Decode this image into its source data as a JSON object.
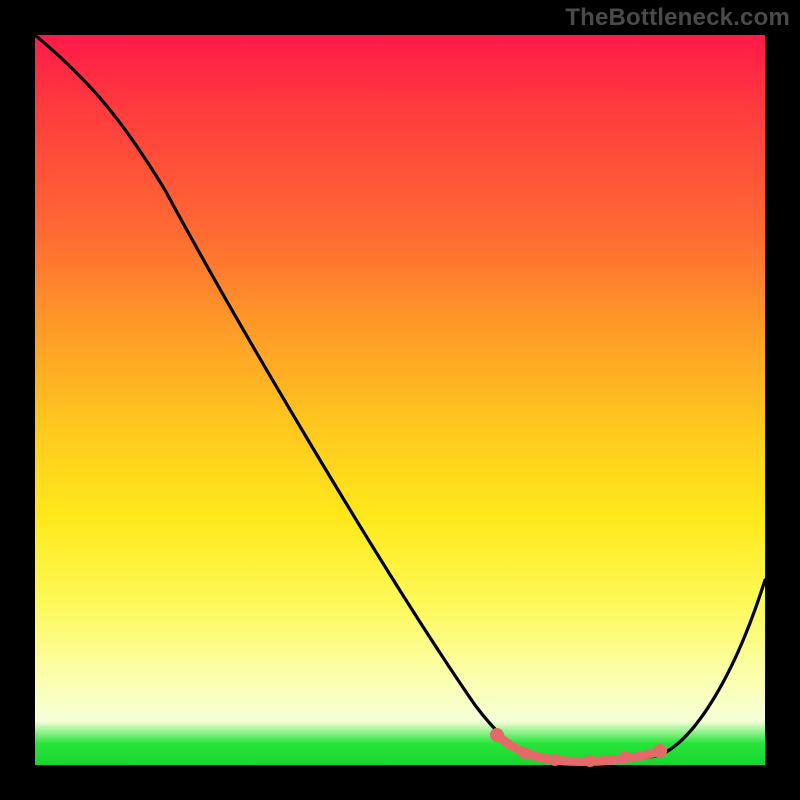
{
  "watermark": "TheBottleneck.com",
  "chart_data": {
    "type": "line",
    "title": "",
    "xlabel": "",
    "ylabel": "",
    "xlim": [
      0,
      100
    ],
    "ylim": [
      0,
      100
    ],
    "series": [
      {
        "name": "bottleneck-curve",
        "x": [
          0,
          10,
          20,
          30,
          40,
          50,
          60,
          65,
          68,
          72,
          76,
          80,
          84,
          88,
          92,
          96,
          100
        ],
        "values": [
          100,
          92,
          80,
          65,
          50,
          35,
          20,
          10,
          4,
          1,
          0,
          0,
          1,
          4,
          10,
          20,
          33
        ]
      }
    ],
    "highlight": {
      "name": "low-bottleneck-zone",
      "x": [
        65,
        68,
        71,
        74,
        77,
        80,
        83,
        86
      ],
      "values": [
        3,
        1,
        0,
        0,
        0,
        0,
        1,
        3
      ],
      "color": "#e46a6a"
    },
    "gradient_stops": [
      {
        "pct": 0,
        "color": "#ff1a49"
      },
      {
        "pct": 27,
        "color": "#ff6a33"
      },
      {
        "pct": 53,
        "color": "#ffc61f"
      },
      {
        "pct": 78,
        "color": "#fdf95a"
      },
      {
        "pct": 94,
        "color": "#f6ffd8"
      },
      {
        "pct": 100,
        "color": "#17d62e"
      }
    ]
  }
}
